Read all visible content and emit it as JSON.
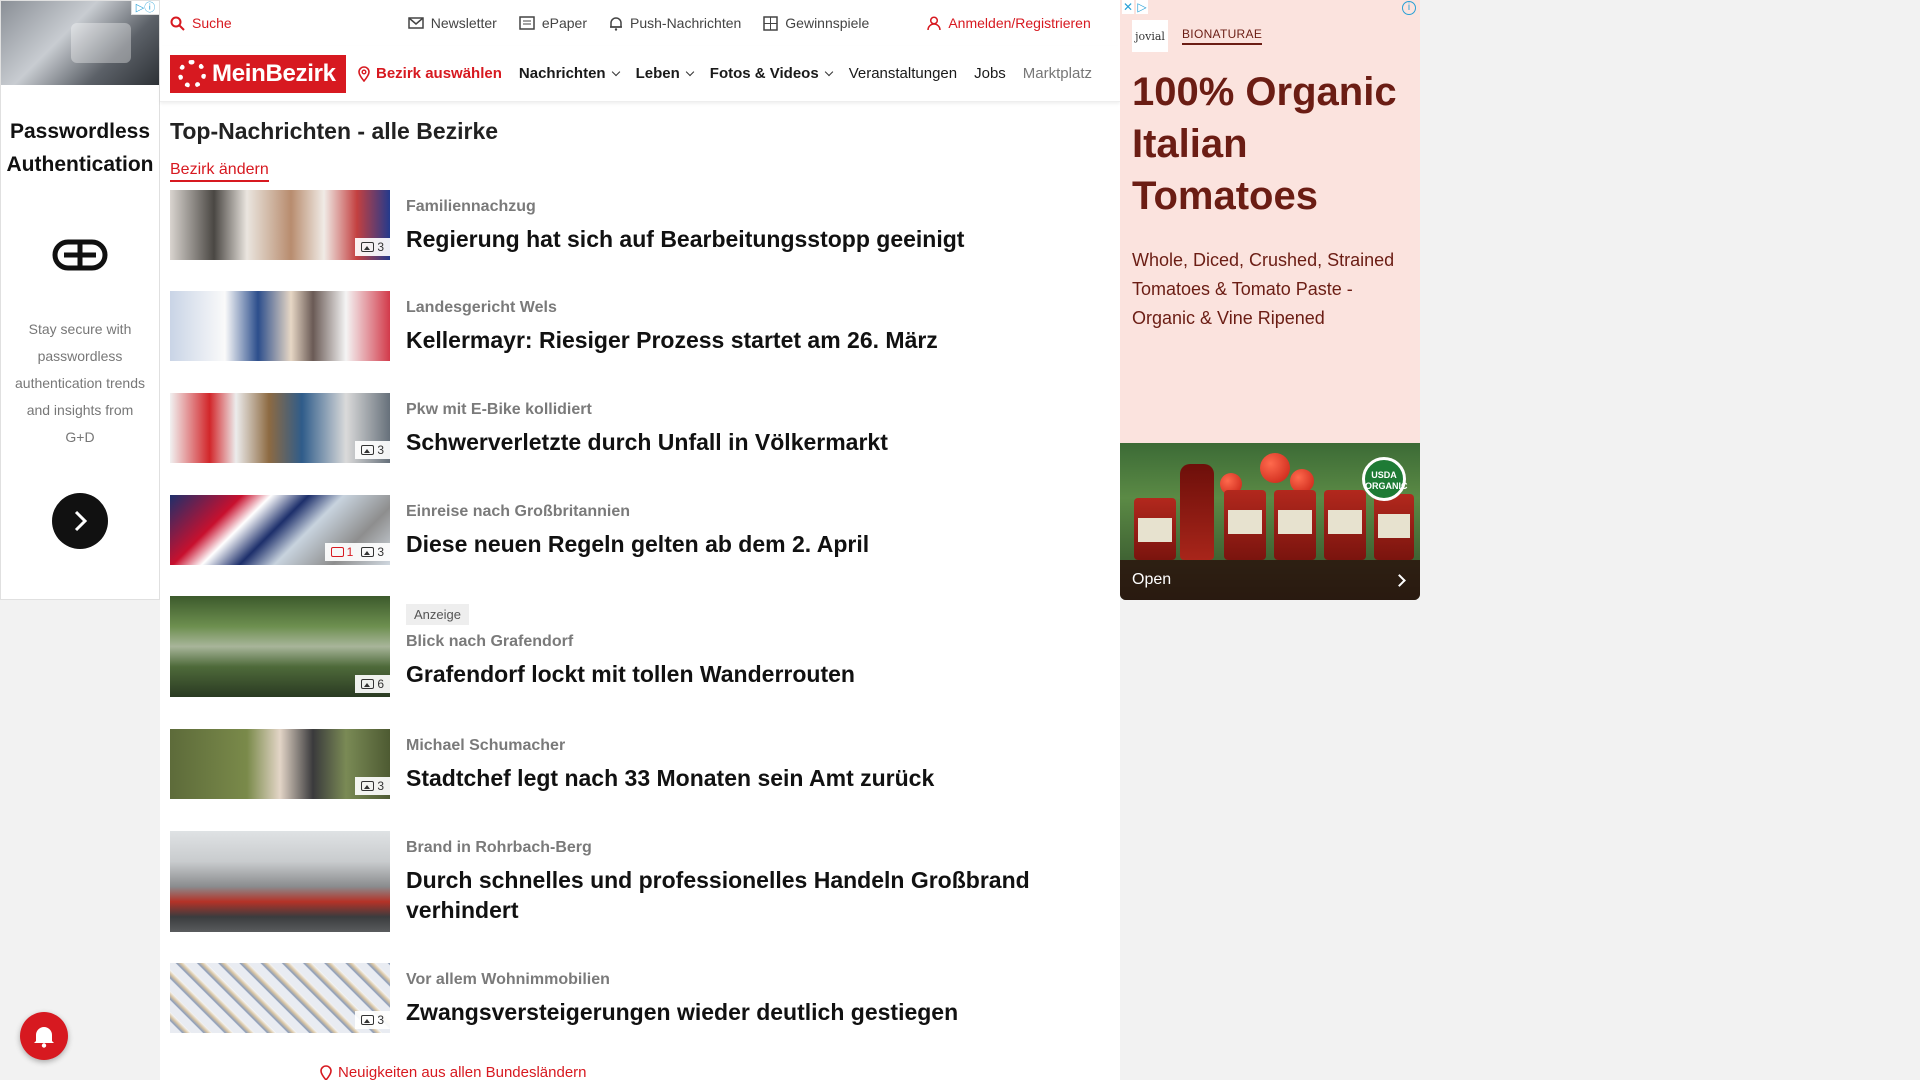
{
  "left_ad": {
    "title": "Passwordless Authentication",
    "text": "Stay secure with passwordless authentication trends and insights from G+D"
  },
  "topbar": {
    "search": "Suche",
    "newsletter": "Newsletter",
    "epaper": "ePaper",
    "push": "Push-Nachrichten",
    "gewinnspiele": "Gewinnspiele",
    "login": "Anmelden/Registrieren"
  },
  "nav": {
    "logo": "MeinBezirk",
    "region": "Bezirk auswählen",
    "items": [
      "Nachrichten",
      "Leben",
      "Fotos & Videos",
      "Veranstaltungen",
      "Jobs",
      "Marktplatz"
    ]
  },
  "page": {
    "title": "Top-Nachrichten - alle Bezirke",
    "change_link": "Bezirk ändern"
  },
  "articles": [
    {
      "kicker": "Familiennachzug",
      "headline": "Regierung hat sich auf Bearbeitungsstopp geeinigt",
      "images": "3"
    },
    {
      "kicker": "Landesgericht Wels",
      "headline": "Kellermayr: Riesiger Prozess startet am 26. März"
    },
    {
      "kicker": "Pkw mit E-Bike kollidiert",
      "headline": "Schwerverletzte durch Unfall in Völkermarkt",
      "images": "3"
    },
    {
      "kicker": "Einreise nach Großbritannien",
      "headline": "Diese neuen Regeln gelten ab dem 2. April",
      "comments": "1",
      "images": "3"
    },
    {
      "badge": "Anzeige",
      "kicker": "Blick nach Grafendorf",
      "headline": "Grafendorf lockt mit tollen Wanderrouten",
      "images": "6"
    },
    {
      "kicker": "Michael Schumacher",
      "headline": "Stadtchef legt nach 33 Monaten sein Amt zurück",
      "images": "3"
    },
    {
      "kicker": "Brand in Rohrbach-Berg",
      "headline": "Durch schnelles und professionelles Handeln Großbrand verhindert"
    },
    {
      "kicker": "Vor allem Wohnimmobilien",
      "headline": "Zwangsversteigerungen wieder deutlich gestiegen",
      "images": "3"
    }
  ],
  "bottom_link": "Neuigkeiten aus allen Bundesländern",
  "right_ad": {
    "logo_text": "jovial",
    "brand": "BIONATURAE",
    "headline": "100% Organic Italian Tomatoes",
    "sub": "Whole, Diced, Crushed, Strained Tomatoes & Tomato Paste - Organic & Vine Ripened",
    "usda": "USDA ORGANIC",
    "open": "Open"
  }
}
